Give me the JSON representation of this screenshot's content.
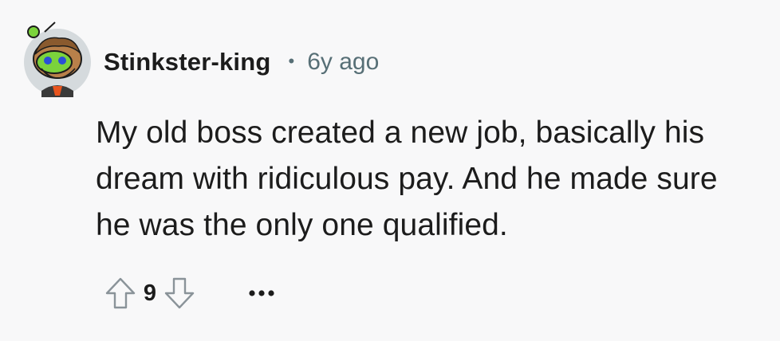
{
  "comment": {
    "author": "Stinkster-king",
    "separator": "•",
    "timestamp": "6y ago",
    "body": "My old boss created a new job, basically his dream with ridiculous pay. And he made sure he was the only one qualified.",
    "score": "9"
  },
  "icons": {
    "avatar": "snoo-avatar-icon",
    "upvote": "arrow-up-outline-icon",
    "downvote": "arrow-down-outline-icon",
    "more": "ellipsis-icon"
  },
  "colors": {
    "background": "#f8f8f9",
    "text": "#1c1c1c",
    "meta": "#576f76",
    "avatar_bg": "#cfd5d9",
    "avatar_green": "#7bd33c"
  }
}
